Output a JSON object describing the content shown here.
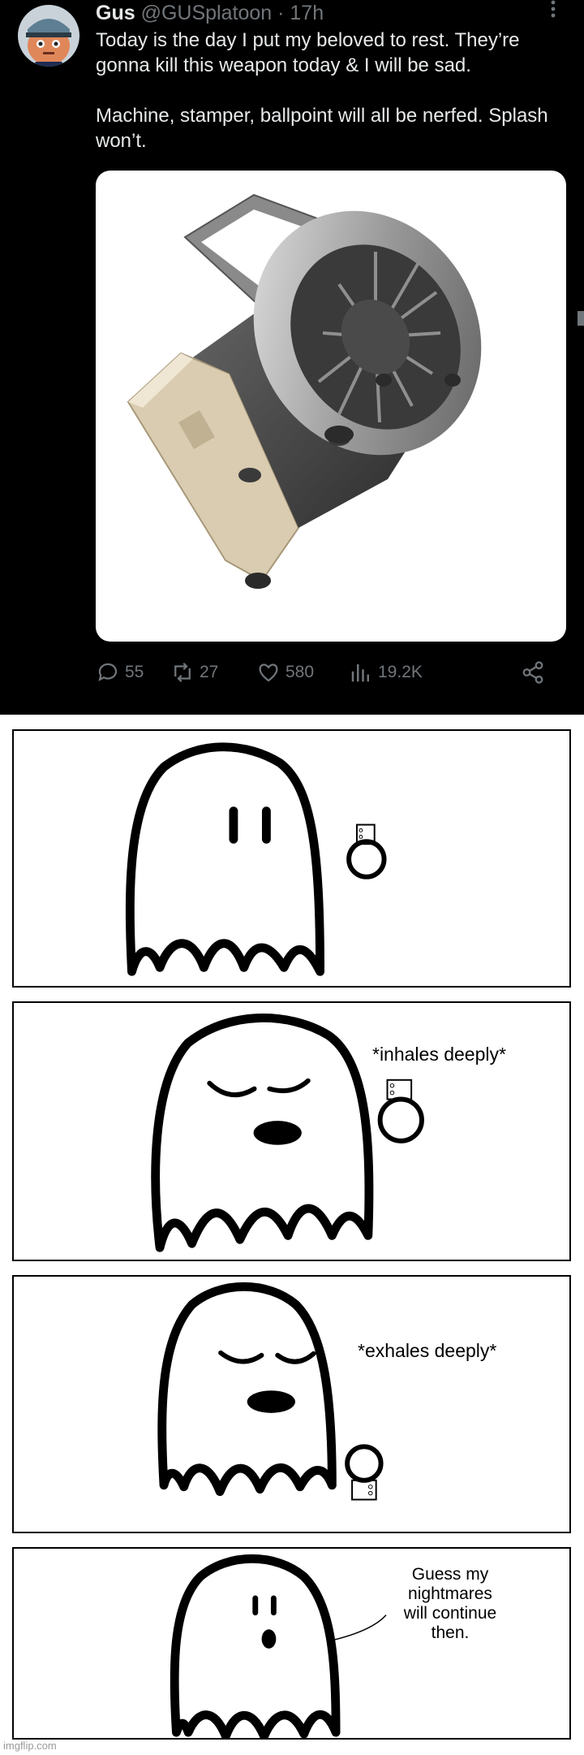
{
  "tweet": {
    "author_name": "Gus",
    "handle": "@GUSplatoon",
    "separator": "·",
    "time": "17h",
    "text_paragraphs": [
      "Today is the day I put my beloved to rest. They’re gonna kill this weapon today & I will be sad.",
      "Machine, stamper, ballpoint will all be nerfed. Splash won’t."
    ],
    "actions": {
      "replies": "55",
      "reposts": "27",
      "likes": "580",
      "views": "19.2K"
    }
  },
  "comic": {
    "panel2_caption": "*inhales deeply*",
    "panel3_caption": "*exhales deeply*",
    "panel4_speech": [
      "Guess my",
      "nightmares",
      "will continue",
      "then."
    ]
  },
  "watermark": "imgflip.com",
  "colors": {
    "tweet_bg": "#000000",
    "text_primary": "#e7e9ea",
    "text_secondary": "#71767b"
  }
}
